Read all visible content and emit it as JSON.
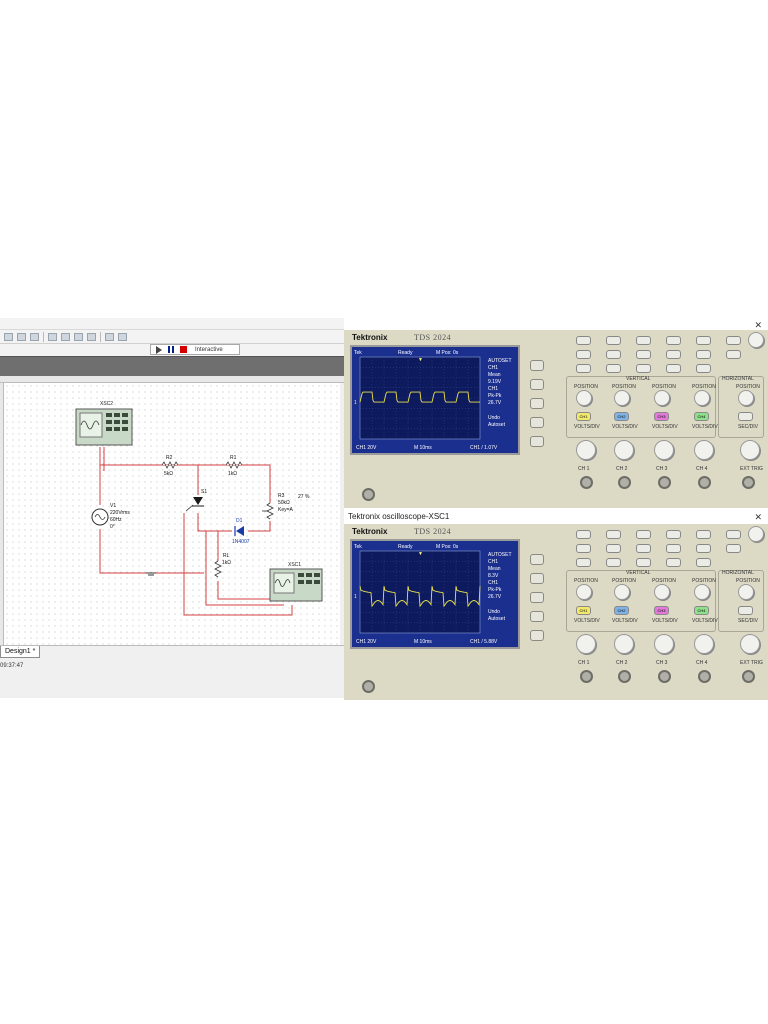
{
  "editor": {
    "sim_mode": "Interactive",
    "tab_label": "Design1 *",
    "status_time": "09:37:47",
    "components": {
      "xsc2_label": "XSC2",
      "xsc1_label": "XSC1",
      "v1_name": "V1",
      "v1_value1": "220Vrms",
      "v1_value2": "60Hz",
      "v1_value3": "0°",
      "r2_name": "R2",
      "r2_value": "5kΩ",
      "r1_name": "R1",
      "r1_value": "1kΩ",
      "r3_name": "R3",
      "r3_value": "50kΩ",
      "r3_pct": "27 %",
      "r3_key": "Key=A",
      "s1_name": "S1",
      "d1_name": "D1",
      "d1_value": "1N4007",
      "rl_name": "RL",
      "rl_value": "1kΩ"
    }
  },
  "scope_top": {
    "title": "",
    "brand": "Tektronix",
    "model": "TDS 2024",
    "status_tek": "Tek",
    "status_ready": "Ready",
    "status_mpos": "M Pos: 0s",
    "menu": [
      "AUTOSET",
      "CH1",
      "Mean",
      "9.19V",
      "CH1",
      "Pk-Pk",
      "26.7V"
    ],
    "undo": [
      "Undo",
      "Autoset"
    ],
    "bottom_ch1": "CH1 20V",
    "bottom_time": "M 10ms",
    "bottom_trig": "CH1 / 1.07V",
    "waveform": "square"
  },
  "scope_bottom": {
    "title": "Tektronix oscilloscope-XSC1",
    "brand": "Tektronix",
    "model": "TDS 2024",
    "status_tek": "Tek",
    "status_ready": "Ready",
    "status_mpos": "M Pos: 0s",
    "menu": [
      "AUTOSET",
      "CH1",
      "Mean",
      "8.3V",
      "CH1",
      "Pk-Pk",
      "26.7V"
    ],
    "undo": [
      "Undo",
      "Autoset"
    ],
    "bottom_ch1": "CH1 20V",
    "bottom_time": "M 10ms",
    "bottom_trig": "CH1 / 5.88V",
    "waveform": "spiky"
  },
  "controls": {
    "vertical": "VERTICAL",
    "horizontal": "HORIZONTAL",
    "position": "POSITION",
    "volts_div": "VOLTS/DIV",
    "sec_div": "SEC/DIV",
    "ch_labels": [
      "CH 1",
      "CH 2",
      "CH 3",
      "CH 4",
      "EXT TRIG"
    ],
    "menu_labels": [
      "CH1",
      "CH2",
      "CH3",
      "CH4"
    ],
    "colors": {
      "ch1": "#f2e86a",
      "ch2": "#7fb3e6",
      "ch3": "#e27ad9",
      "ch4": "#8fe08a",
      "trace": "#e8e24a",
      "screen": "#1b2f8f"
    }
  }
}
